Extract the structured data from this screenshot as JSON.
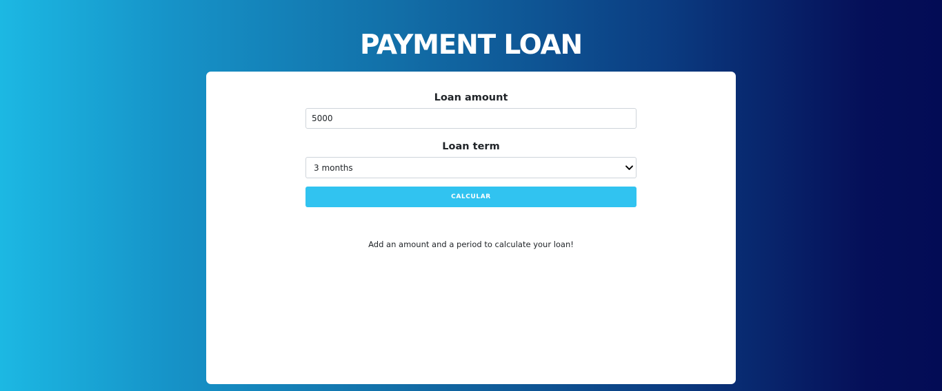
{
  "header": {
    "title": "PAYMENT LOAN"
  },
  "form": {
    "amount_label": "Loan amount",
    "amount_value": "5000",
    "term_label": "Loan term",
    "term_selected": "3 months",
    "calculate_label": "CALCULAR"
  },
  "result": {
    "message": "Add an amount and a period to calculate your loan!"
  },
  "colors": {
    "button": "#31c3f0",
    "gradient_start": "#1cb8e3",
    "gradient_end": "#030c55"
  }
}
